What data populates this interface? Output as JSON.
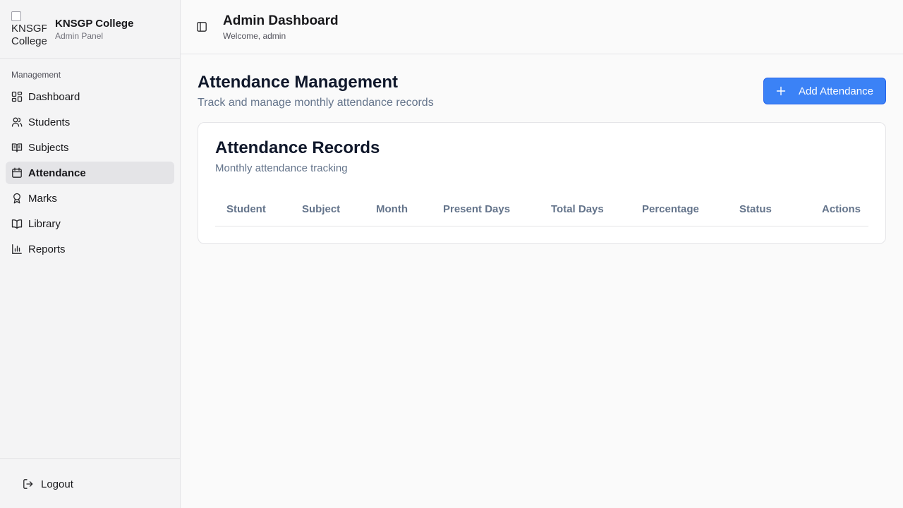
{
  "brand": {
    "logo_alt": "KNSGP College",
    "name": "KNSGP College",
    "subtitle": "Admin Panel"
  },
  "sidebar": {
    "group_label": "Management",
    "items": [
      {
        "label": "Dashboard",
        "icon": "dashboard-icon"
      },
      {
        "label": "Students",
        "icon": "users-icon"
      },
      {
        "label": "Subjects",
        "icon": "book-open-icon"
      },
      {
        "label": "Attendance",
        "icon": "calendar-icon",
        "active": true
      },
      {
        "label": "Marks",
        "icon": "award-icon"
      },
      {
        "label": "Library",
        "icon": "library-book-icon"
      },
      {
        "label": "Reports",
        "icon": "bar-chart-icon"
      }
    ],
    "logout_label": "Logout"
  },
  "topbar": {
    "title": "Admin Dashboard",
    "subtitle": "Welcome, admin"
  },
  "page": {
    "title": "Attendance Management",
    "subtitle": "Track and manage monthly attendance records",
    "add_button_label": "Add Attendance"
  },
  "card": {
    "title": "Attendance Records",
    "subtitle": "Monthly attendance tracking",
    "columns": [
      "Student",
      "Subject",
      "Month",
      "Present Days",
      "Total Days",
      "Percentage",
      "Status",
      "Actions"
    ]
  },
  "colors": {
    "accent": "#3b82f6",
    "sidebar_bg": "#f4f4f5",
    "active_item_bg": "#e4e4e7"
  }
}
